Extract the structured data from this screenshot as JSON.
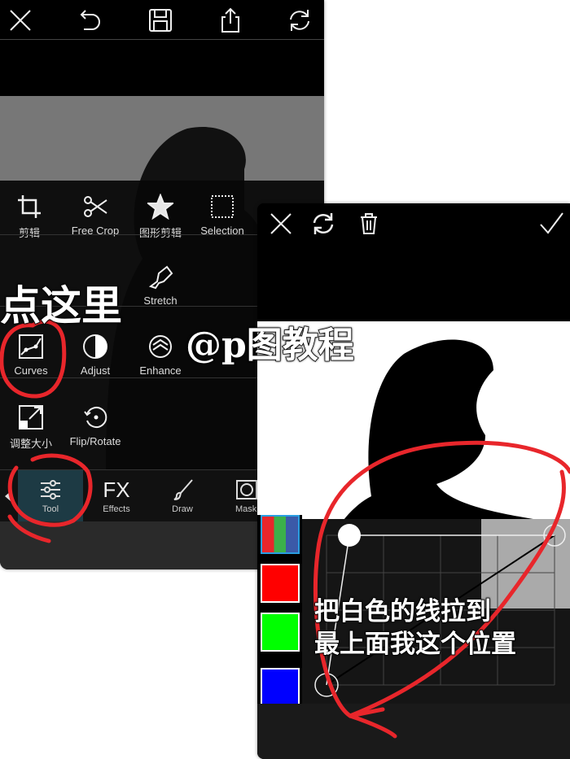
{
  "left_screen": {
    "top_bar": [
      "close-icon",
      "undo-icon",
      "save-icon",
      "share-icon",
      "refresh-icon"
    ],
    "tools": [
      {
        "label": "剪辑",
        "icon": "crop-icon"
      },
      {
        "label": "Free Crop",
        "icon": "scissors-icon"
      },
      {
        "label": "图形剪辑",
        "icon": "star-icon"
      },
      {
        "label": "Selection",
        "icon": "selection-icon"
      },
      {
        "label": "Stretch",
        "icon": "stretch-icon"
      },
      {
        "label": "Curves",
        "icon": "curves-icon"
      },
      {
        "label": "Adjust",
        "icon": "adjust-icon"
      },
      {
        "label": "Enhance",
        "icon": "enhance-icon"
      },
      {
        "label": "调整大小",
        "icon": "resize-icon"
      },
      {
        "label": "Flip/Rotate",
        "icon": "rotate-icon"
      }
    ],
    "tabs": [
      {
        "label": "Tool",
        "icon": "sliders-icon",
        "active": true
      },
      {
        "label": "Effects",
        "icon": "fx-icon"
      },
      {
        "label": "Draw",
        "icon": "brush-icon"
      },
      {
        "label": "Mask",
        "icon": "mask-icon"
      }
    ],
    "fx_glyph": "FX",
    "tab_active_color": "#1d3a44"
  },
  "right_screen": {
    "top_bar": [
      "close-icon",
      "refresh-icon",
      "trash-icon",
      "check-icon"
    ],
    "channels": [
      {
        "name": "rgb",
        "color": "#e8e8e8"
      },
      {
        "name": "red",
        "color": "#ff0000"
      },
      {
        "name": "green",
        "color": "#00ff00"
      },
      {
        "name": "blue",
        "color": "#0000ff"
      }
    ]
  },
  "annotations": {
    "click_here": "点这里",
    "watermark": "@p图教程",
    "instruction_line1": "把白色的线拉到",
    "instruction_line2": "最上面我这个位置",
    "highlight_color": "#e8262b"
  }
}
